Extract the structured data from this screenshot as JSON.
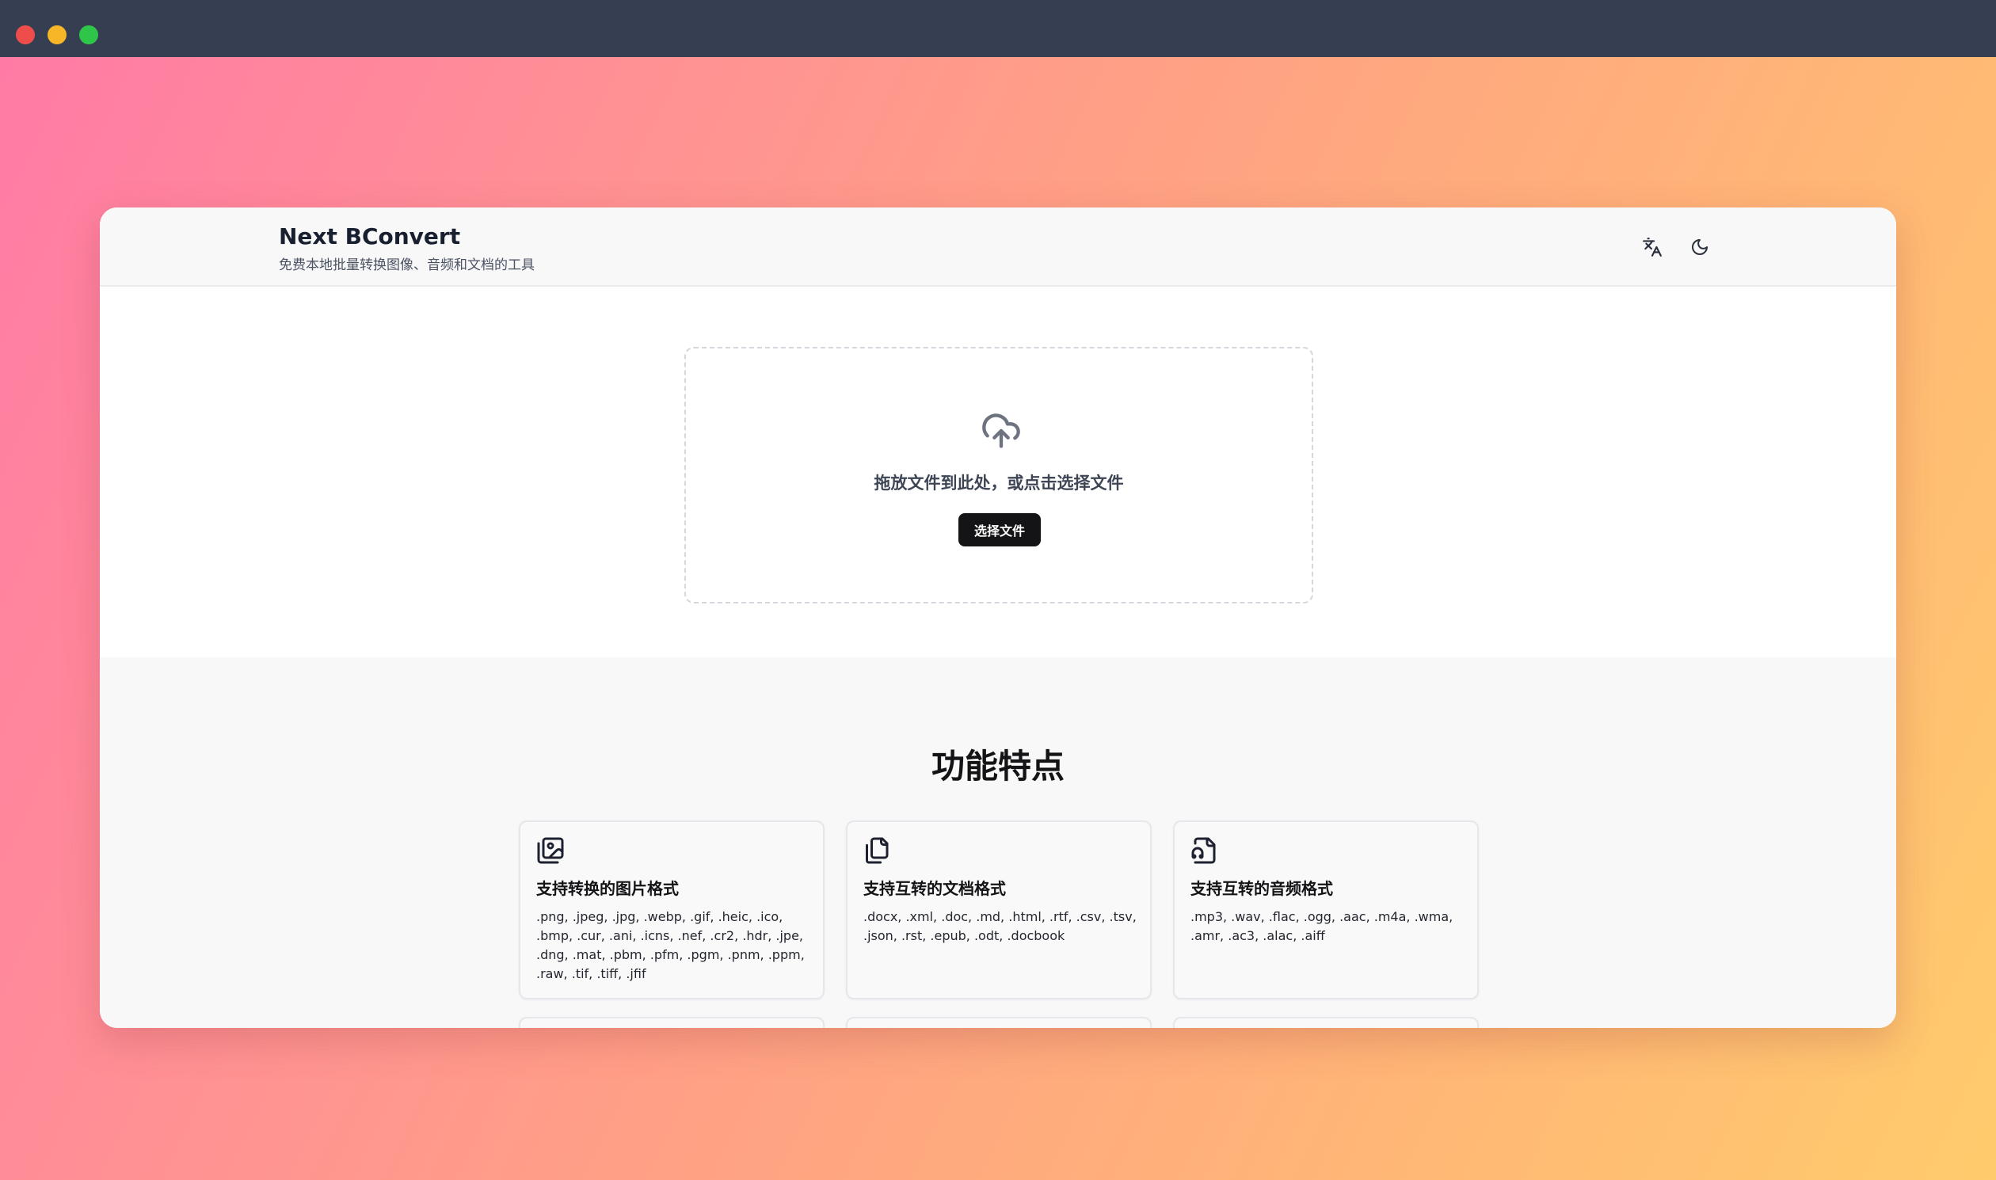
{
  "app": {
    "title": "Next BConvert",
    "subtitle": "免费本地批量转换图像、音频和文档的工具"
  },
  "header": {
    "icons": [
      "translate-icon",
      "moon-icon"
    ]
  },
  "upload": {
    "instruction": "拖放文件到此处，或点击选择文件",
    "button_label": "选择文件",
    "icon": "cloud-upload-icon"
  },
  "features": {
    "title": "功能特点",
    "cards": [
      {
        "icon": "images-icon",
        "title": "支持转换的图片格式",
        "formats": ".png, .jpeg, .jpg, .webp, .gif, .heic, .ico, .bmp, .cur, .ani, .icns, .nef, .cr2, .hdr, .jpe, .dng, .mat, .pbm, .pfm, .pgm, .pnm, .ppm, .raw, .tif, .tiff, .jfif"
      },
      {
        "icon": "documents-icon",
        "title": "支持互转的文档格式",
        "formats": ".docx, .xml, .doc, .md, .html, .rtf, .csv, .tsv, .json, .rst, .epub, .odt, .docbook"
      },
      {
        "icon": "audio-file-icon",
        "title": "支持互转的音频格式",
        "formats": ".mp3, .wav, .flac, .ogg, .aac, .m4a, .wma, .amr, .ac3, .alac, .aiff"
      }
    ]
  },
  "colors": {
    "titlebar": "#363f51",
    "button": "#141416",
    "traffic_red": "#ee4d4b",
    "traffic_yellow": "#f6b627",
    "traffic_green": "#2ec548"
  }
}
